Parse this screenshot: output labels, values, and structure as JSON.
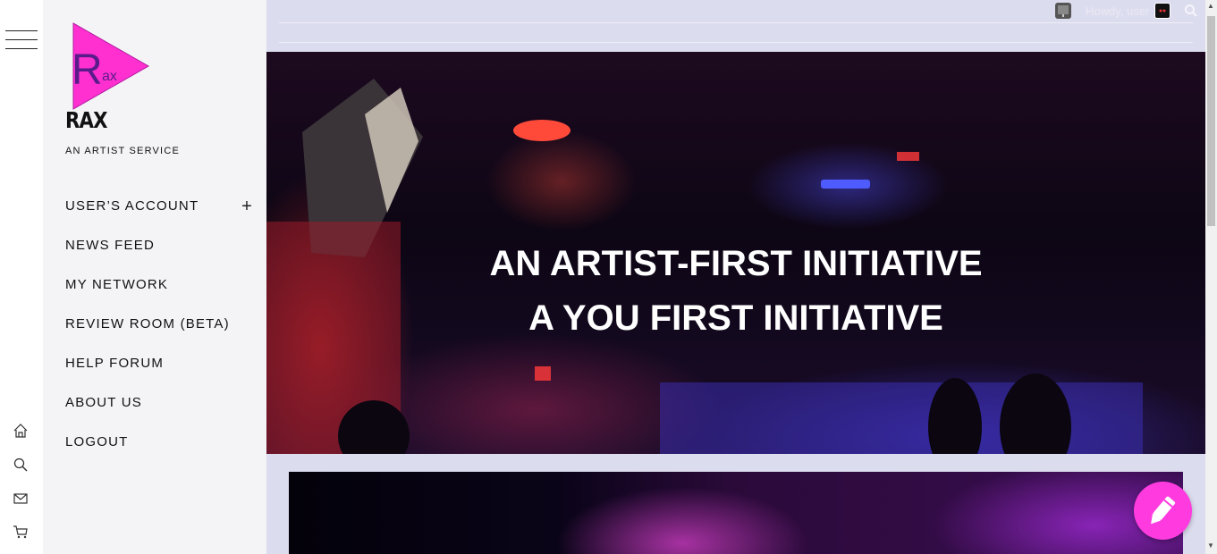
{
  "site": {
    "logo_letters": "Rax",
    "title": "RAX",
    "tagline": "AN ARTIST SERVICE"
  },
  "menu": {
    "items": [
      {
        "label": "USER’S ACCOUNT",
        "expandable": true
      },
      {
        "label": "NEWS FEED"
      },
      {
        "label": "MY NETWORK"
      },
      {
        "label": "REVIEW ROOM (BETA)"
      },
      {
        "label": "HELP FORUM"
      },
      {
        "label": "ABOUT US"
      },
      {
        "label": "LOGOUT"
      }
    ],
    "expand_symbol": "+"
  },
  "rail": {
    "icons": [
      "home-icon",
      "search-icon",
      "mail-icon",
      "cart-icon"
    ]
  },
  "topbar": {
    "greeting": "Howdy, user"
  },
  "hero": {
    "line1": "AN ARTIST-FIRST INITIATIVE",
    "line2": "A YOU FIRST INITIATIVE"
  },
  "colors": {
    "accent": "#ff3be0",
    "logo_magenta": "#ff2fd0",
    "topbar": "#dcdcef",
    "sidebar": "#f4f4f7"
  }
}
